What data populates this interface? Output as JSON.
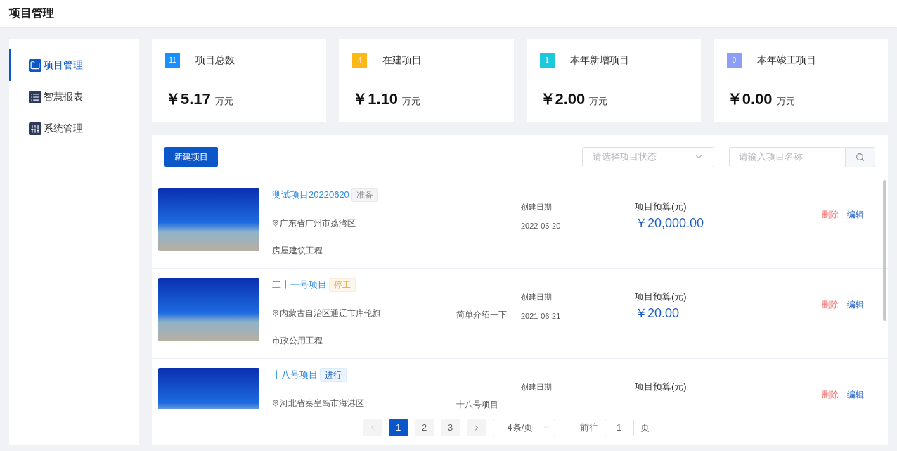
{
  "header": {
    "title": "项目管理"
  },
  "sidebar": {
    "items": [
      {
        "label": "项目管理",
        "kind": "folder",
        "selected": true
      },
      {
        "label": "智慧报表",
        "kind": "list",
        "selected": false
      },
      {
        "label": "系统管理",
        "kind": "sliders",
        "selected": false
      }
    ]
  },
  "stats": [
    {
      "count": "11",
      "color": "#1890ff",
      "label": "项目总数",
      "amount": "￥5.17",
      "unit": "万元"
    },
    {
      "count": "4",
      "color": "#fbb817",
      "label": "在建项目",
      "amount": "￥1.10",
      "unit": "万元"
    },
    {
      "count": "1",
      "color": "#1cc8dc",
      "label": "本年新增项目",
      "amount": "￥2.00",
      "unit": "万元"
    },
    {
      "count": "0",
      "color": "#8c9ef8",
      "label": "本年竣工项目",
      "amount": "￥0.00",
      "unit": "万元"
    }
  ],
  "toolbar": {
    "new_button": "新建项目",
    "status_select": {
      "placeholder": "请选择项目状态"
    },
    "search": {
      "placeholder": "请输入项目名称"
    }
  },
  "projects": [
    {
      "name": "测试项目20220620",
      "tag": {
        "text": "准备",
        "kind": "info"
      },
      "location": "广东省广州市荔湾区",
      "category": "房屋建筑工程",
      "date_label": "创建日期",
      "date": "2022-05-20",
      "budget_label": "项目预算(元)",
      "budget": "￥20,000.00",
      "delete": "删除",
      "edit": "编辑"
    },
    {
      "name": "二十一号项目",
      "tag": {
        "text": "停工",
        "kind": "warning"
      },
      "location": "内蒙古自治区通辽市库伦旗",
      "category": "市政公用工程",
      "description": "简单介绍一下",
      "date_label": "创建日期",
      "date": "2021-06-21",
      "budget_label": "项目预算(元)",
      "budget": "￥20.00",
      "delete": "删除",
      "edit": "编辑"
    },
    {
      "name": "十八号项目",
      "tag": {
        "text": "进行",
        "kind": "primary"
      },
      "location": "河北省秦皇岛市海港区",
      "description": "十八号项目",
      "date_label": "创建日期",
      "budget_label": "项目预算(元)",
      "delete": "删除",
      "edit": "编辑"
    }
  ],
  "pagination": {
    "pages": [
      {
        "label": "1",
        "selected": true
      },
      {
        "label": "2",
        "selected": false
      },
      {
        "label": "3",
        "selected": false
      }
    ],
    "page_size": "4条/页",
    "goto_label": "前往",
    "goto_value": "1",
    "page_unit": "页"
  }
}
